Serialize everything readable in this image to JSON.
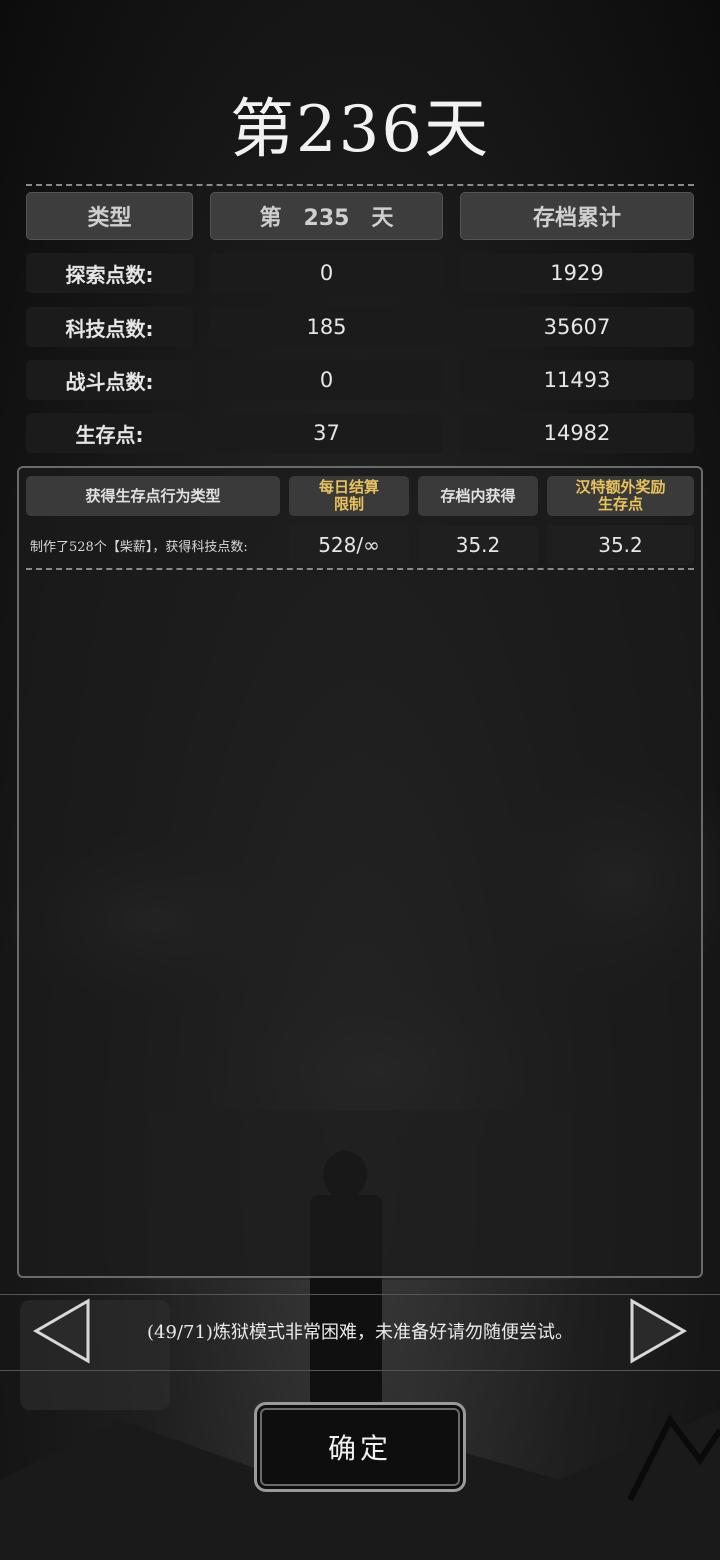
{
  "title": "第236天",
  "stats": {
    "header": {
      "type": "类型",
      "day": "第　235　天",
      "total": "存档累计"
    },
    "rows": [
      {
        "label": "探索点数:",
        "day": "0",
        "total": "1929"
      },
      {
        "label": "科技点数:",
        "day": "185",
        "total": "35607"
      },
      {
        "label": "战斗点数:",
        "day": "0",
        "total": "11493"
      },
      {
        "label": "生存点:",
        "day": "37",
        "total": "14982"
      }
    ]
  },
  "actions": {
    "headers": {
      "type": "获得生存点行为类型",
      "limit_line1": "每日结算",
      "limit_line2": "限制",
      "gain": "存档内获得",
      "bonus_line1": "汉特额外奖励",
      "bonus_line2": "生存点"
    },
    "rows": [
      {
        "desc": "制作了528个【柴薪】，获得科技点数:",
        "limit": "528/∞",
        "gain": "35.2",
        "bonus": "35.2"
      }
    ]
  },
  "tip": "(49/71)炼狱模式非常困难，未准备好请勿随便尝试。",
  "confirm_label": "确定",
  "colors": {
    "gold_header": "#e8c25a",
    "header_bg": "#3d3d3d",
    "cell_bg": "#1b1b1b"
  },
  "icons": {
    "prev": "left-triangle-arrow-icon",
    "next": "right-triangle-arrow-icon"
  }
}
